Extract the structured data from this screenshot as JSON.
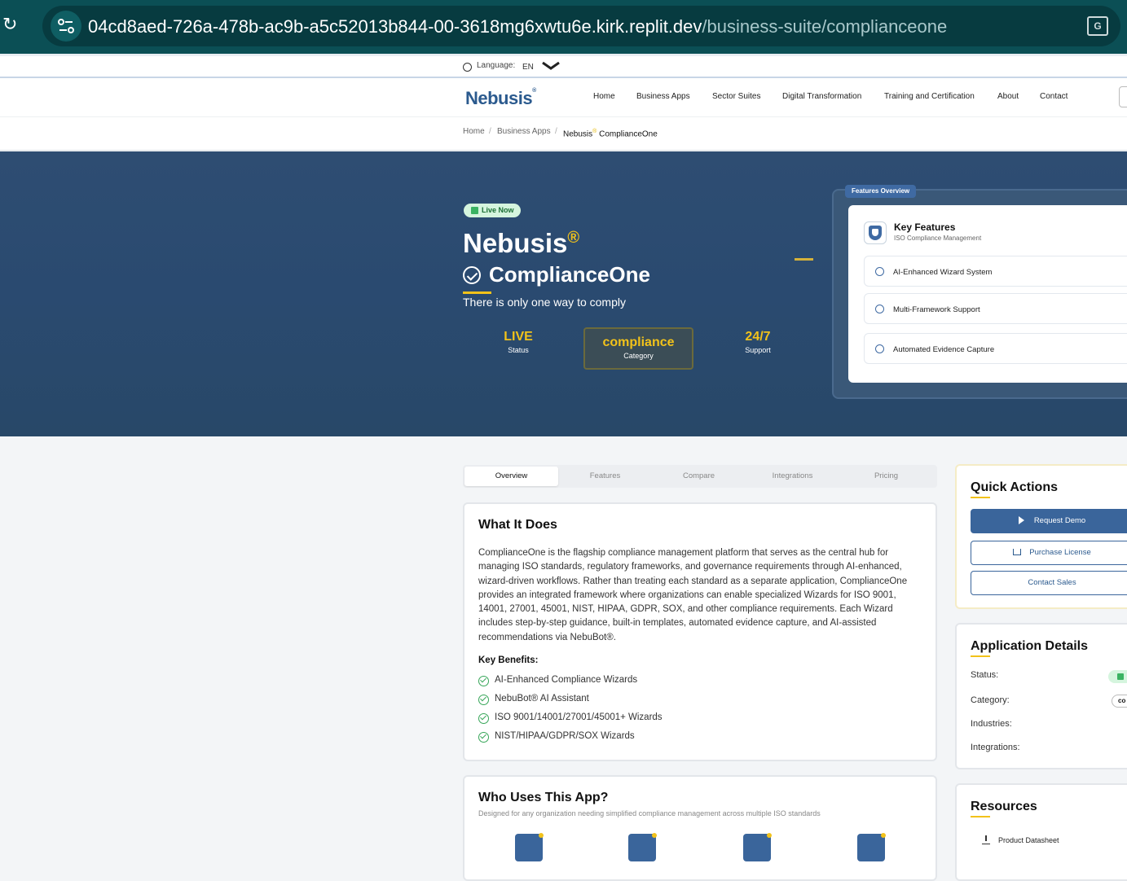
{
  "browser": {
    "url_host": "04cd8aed-726a-478b-ac9b-a5c52013b844-00-3618mg6xwtu6e.kirk.replit.dev",
    "url_path": "/business-suite/complianceone",
    "reload_icon": "reload-icon",
    "translate_icon": "translate-icon"
  },
  "language_bar": {
    "label": "Language:",
    "value": "EN"
  },
  "nav": {
    "logo": "Nebusis",
    "logo_mark": "®",
    "items": [
      "Home",
      "Business Apps",
      "Sector Suites",
      "Digital Transformation",
      "Training and Certification",
      "About",
      "Contact"
    ]
  },
  "breadcrumb": {
    "items": [
      "Home",
      "Business Apps"
    ],
    "current_prefix": "Nebusis",
    "current_mark": "®",
    "current_suffix": " ComplianceOne"
  },
  "hero": {
    "badge": "Live Now",
    "title": "Nebusis",
    "title_mark": "®",
    "product": "ComplianceOne",
    "tagline": "There is only one way to comply",
    "stats": [
      {
        "value": "LIVE",
        "label": "Status"
      },
      {
        "value": "compliance",
        "label": "Category"
      },
      {
        "value": "24/7",
        "label": "Support"
      }
    ],
    "features_tag": "Features Overview",
    "features_title": "Key Features",
    "features_subtitle": "ISO Compliance Management",
    "features": [
      "AI-Enhanced Wizard System",
      "Multi-Framework Support",
      "Automated Evidence Capture"
    ]
  },
  "tabs": [
    "Overview",
    "Features",
    "Compare",
    "Integrations",
    "Pricing"
  ],
  "what": {
    "title": "What It Does",
    "body": "ComplianceOne is the flagship compliance management platform that serves as the central hub for managing ISO standards, regulatory frameworks, and governance requirements through AI-enhanced, wizard-driven workflows. Rather than treating each standard as a separate application, ComplianceOne provides an integrated framework where organizations can enable specialized Wizards for ISO 9001, 14001, 27001, 45001, NIST, HIPAA, GDPR, SOX, and other compliance requirements. Each Wizard includes step-by-step guidance, built-in templates, automated evidence capture, and AI-assisted recommendations via NebuBot®.",
    "benefits_title": "Key Benefits:",
    "benefits": [
      "AI-Enhanced Compliance Wizards",
      "NebuBot® AI Assistant",
      "ISO 9001/14001/27001/45001+ Wizards",
      "NIST/HIPAA/GDPR/SOX Wizards"
    ]
  },
  "who": {
    "title": "Who Uses This App?",
    "subtitle": "Designed for any organization needing simplified compliance management across multiple ISO standards"
  },
  "quick_actions": {
    "title": "Quick Actions",
    "request_demo": "Request Demo",
    "purchase": "Purchase License",
    "contact": "Contact Sales"
  },
  "details": {
    "title": "Application Details",
    "status_label": "Status:",
    "category_label": "Category:",
    "category_value": "co",
    "industries_label": "Industries:",
    "integrations_label": "Integrations:"
  },
  "resources": {
    "title": "Resources",
    "items": [
      "Product Datasheet"
    ]
  }
}
